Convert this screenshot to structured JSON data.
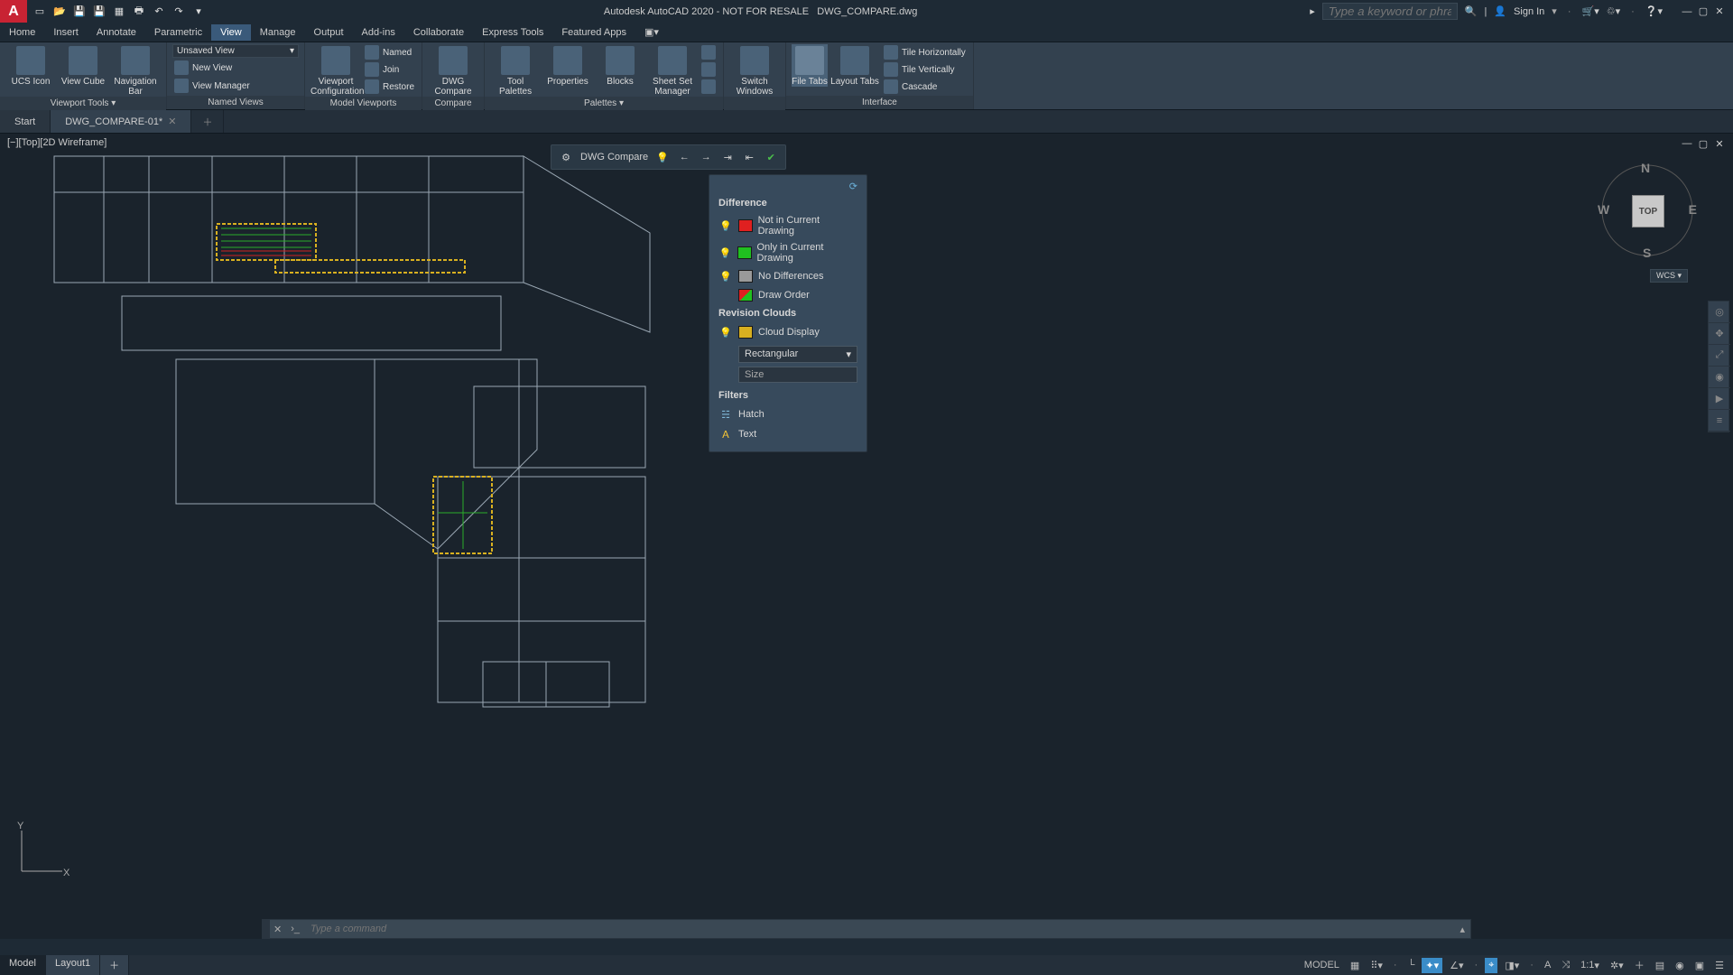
{
  "app": {
    "title_prefix": "Autodesk AutoCAD 2020 - NOT FOR RESALE",
    "filename": "DWG_COMPARE.dwg",
    "logo_letter": "A"
  },
  "titlebar": {
    "search_placeholder": "Type a keyword or phrase",
    "signin": "Sign In"
  },
  "menu": {
    "tabs": [
      "Home",
      "Insert",
      "Annotate",
      "Parametric",
      "View",
      "Manage",
      "Output",
      "Add-ins",
      "Collaborate",
      "Express Tools",
      "Featured Apps"
    ],
    "active": "View"
  },
  "ribbon": {
    "unsaved_view": "Unsaved View",
    "viewport_tools": {
      "ucs": "UCS Icon",
      "viewcube": "View Cube",
      "navbar": "Navigation Bar",
      "panel": "Viewport Tools"
    },
    "named_views": {
      "new": "New View",
      "manager": "View Manager",
      "panel": "Named Views"
    },
    "model_viewports": {
      "config": "Viewport Configuration",
      "named": "Named",
      "join": "Join",
      "restore": "Restore",
      "panel": "Model Viewports"
    },
    "compare": {
      "btn": "DWG Compare",
      "panel": "Compare"
    },
    "palettes": {
      "tool": "Tool Palettes",
      "props": "Properties",
      "blocks": "Blocks",
      "sheet": "Sheet Set Manager",
      "panel": "Palettes"
    },
    "windows": {
      "switch": "Switch Windows"
    },
    "interface": {
      "filetabs": "File Tabs",
      "layouttabs": "Layout Tabs",
      "tileh": "Tile Horizontally",
      "tilev": "Tile Vertically",
      "cascade": "Cascade",
      "panel": "Interface"
    }
  },
  "filetabs": {
    "start": "Start",
    "active": "DWG_COMPARE-01*"
  },
  "viewport": {
    "label": "[−][Top][2D Wireframe]"
  },
  "compare_toolbar": {
    "title": "DWG Compare"
  },
  "compare_panel": {
    "difference": "Difference",
    "not_in_current": "Not in Current Drawing",
    "only_in_current": "Only in Current Drawing",
    "no_differences": "No Differences",
    "draw_order": "Draw Order",
    "revision_clouds": "Revision Clouds",
    "cloud_display": "Cloud Display",
    "shape": "Rectangular",
    "size_placeholder": "Size",
    "filters": "Filters",
    "hatch": "Hatch",
    "text": "Text",
    "colors": {
      "not_in_current": "#e02020",
      "only_in_current": "#20c020",
      "no_differences": "#9a9a9a",
      "cloud": "#d8b020"
    }
  },
  "viewcube": {
    "top": "TOP",
    "n": "N",
    "s": "S",
    "e": "E",
    "w": "W",
    "wcs": "WCS"
  },
  "cmd": {
    "placeholder": "Type a command"
  },
  "status": {
    "layouts": [
      "Model",
      "Layout1"
    ],
    "model_label": "MODEL",
    "ratio": "1:1"
  }
}
